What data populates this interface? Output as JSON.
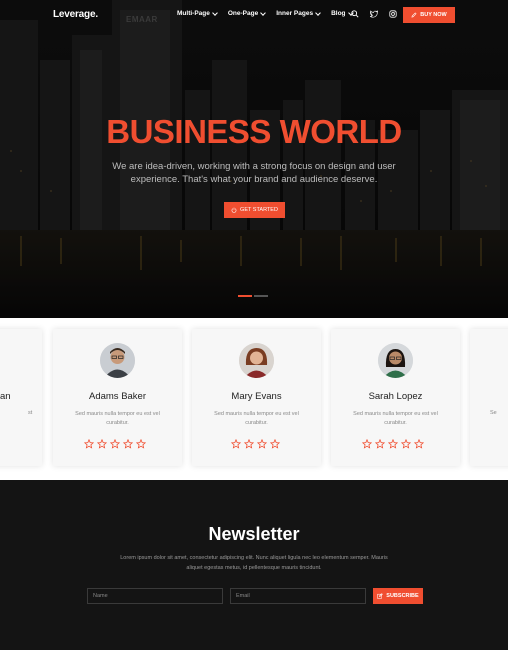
{
  "nav": {
    "logo": "Leverage.",
    "menu": [
      "Multi-Page",
      "One-Page",
      "Inner Pages",
      "Blog"
    ],
    "icons": [
      "search-icon",
      "twitter-icon",
      "instagram-icon"
    ],
    "buy_label": "BUY NOW"
  },
  "hero": {
    "building_sign": "EMAAR",
    "title": "BUSINESS WORLD",
    "subtitle": "We are idea-driven, working with a strong focus on design and user experience. That's what your brand and audience deserve.",
    "cta_label": "GET STARTED",
    "slides": 2,
    "active_slide": 1
  },
  "team": {
    "partial_left": {
      "name_fragment": "an",
      "text_fragment": "st"
    },
    "cards": [
      {
        "name": "Adams Baker",
        "text": "Sed mauris nulla tempor eu est vel curabitur.",
        "rating_max": 5
      },
      {
        "name": "Mary Evans",
        "text": "Sed mauris nulla tempor eu est vel curabitur.",
        "rating_max": 4
      },
      {
        "name": "Sarah Lopez",
        "text": "Sed mauris nulla tempor eu est vel curabitur.",
        "rating_max": 5
      }
    ],
    "partial_right": {
      "text_fragment": "Se"
    }
  },
  "newsletter": {
    "title": "Newsletter",
    "text": "Lorem ipsum dolor sit amet, consectetur adipiscing elit. Nunc aliquet ligula nec leo elementum semper. Mauris aliquet egestas metus, id pellentesque mauris tincidunt.",
    "name_placeholder": "Name",
    "email_placeholder": "Email",
    "subscribe_label": "SUBSCRIBE"
  },
  "colors": {
    "accent": "#f04e30",
    "dark": "#141414",
    "card": "#f7f7f7"
  }
}
